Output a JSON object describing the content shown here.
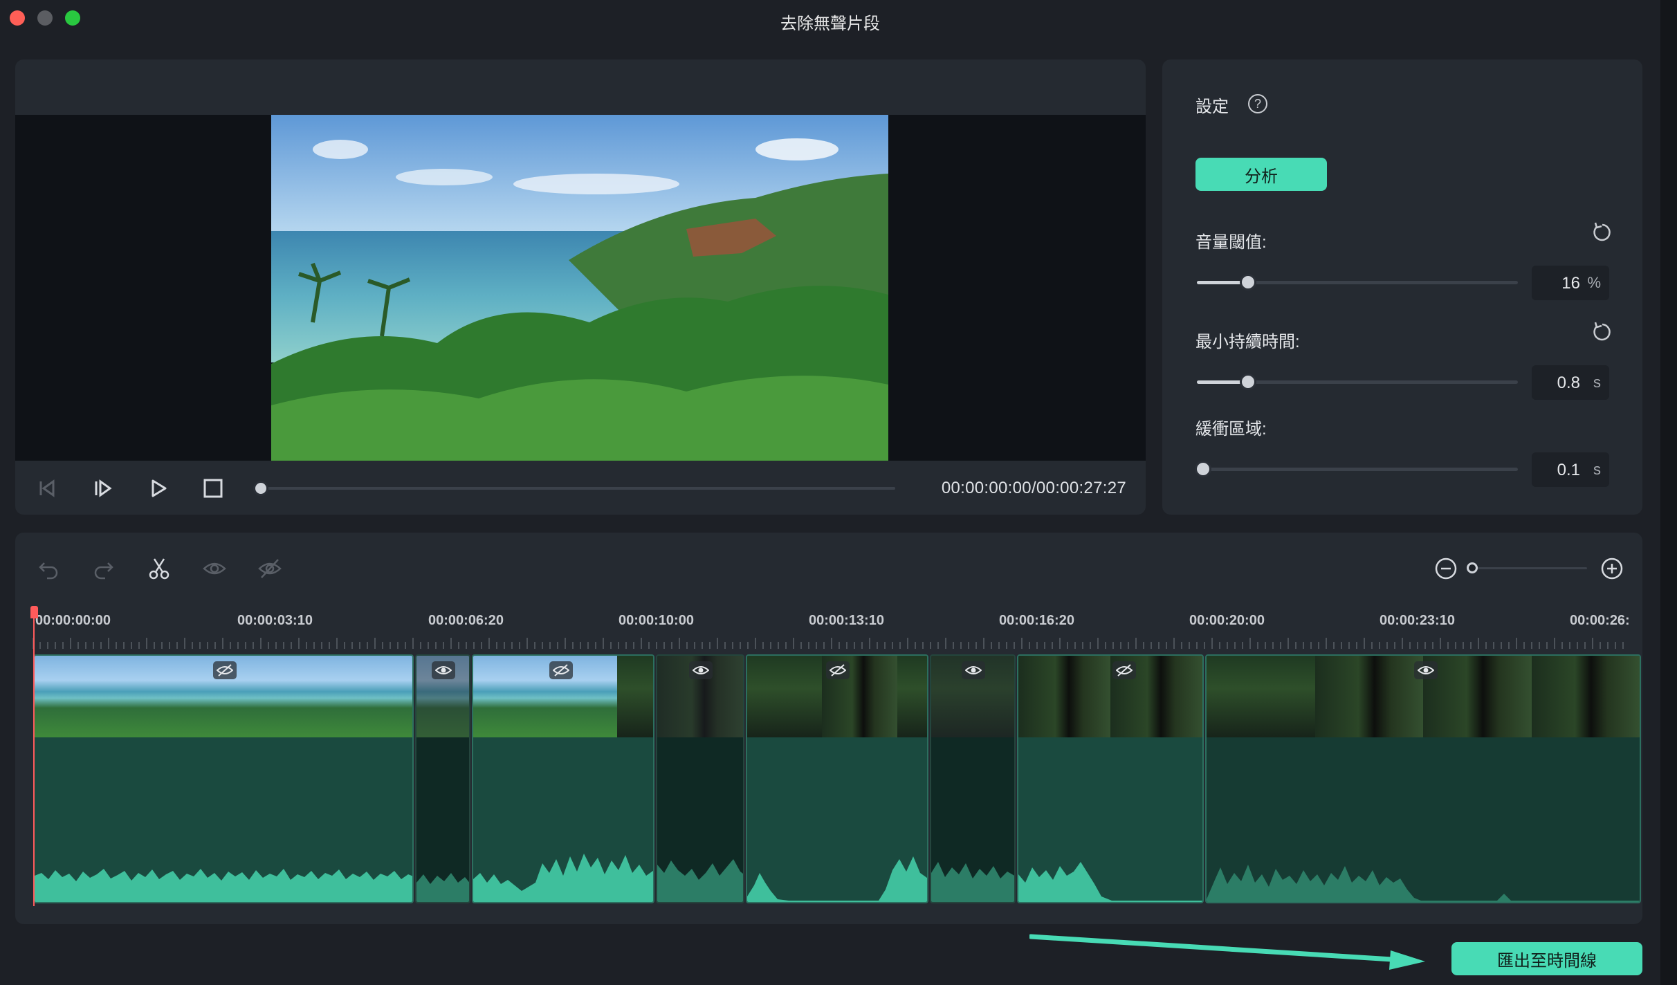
{
  "window": {
    "title": "去除無聲片段"
  },
  "preview": {
    "timecode": "00:00:00:00/00:00:27:27",
    "progress": 0
  },
  "settings": {
    "title": "設定",
    "help_glyph": "?",
    "analyze_label": "分析",
    "volume_threshold": {
      "label": "音量閾值:",
      "value": "16",
      "unit": "%",
      "level": 0.16
    },
    "min_duration": {
      "label": "最小持續時間:",
      "value": "0.8",
      "unit": "s",
      "level": 0.16
    },
    "buffer_zone": {
      "label": "緩衝區域:",
      "value": "0.1",
      "unit": "s",
      "level": 0.02
    }
  },
  "timeline": {
    "zoom_level": 0,
    "ruler_labels": [
      "00:00:00:00",
      "00:00:03:10",
      "00:00:06:20",
      "00:00:10:00",
      "00:00:13:10",
      "00:00:16:20",
      "00:00:20:00",
      "00:00:23:10",
      "00:00:26:"
    ],
    "tools": [
      "undo-icon",
      "redo-icon",
      "scissors-icon",
      "eye-icon",
      "eye-off-icon"
    ]
  },
  "export_label": "匯出至時間線",
  "colors": {
    "accent": "#48dbb5",
    "playhead": "#ff5b5b",
    "wave": "#3fbf9c"
  }
}
